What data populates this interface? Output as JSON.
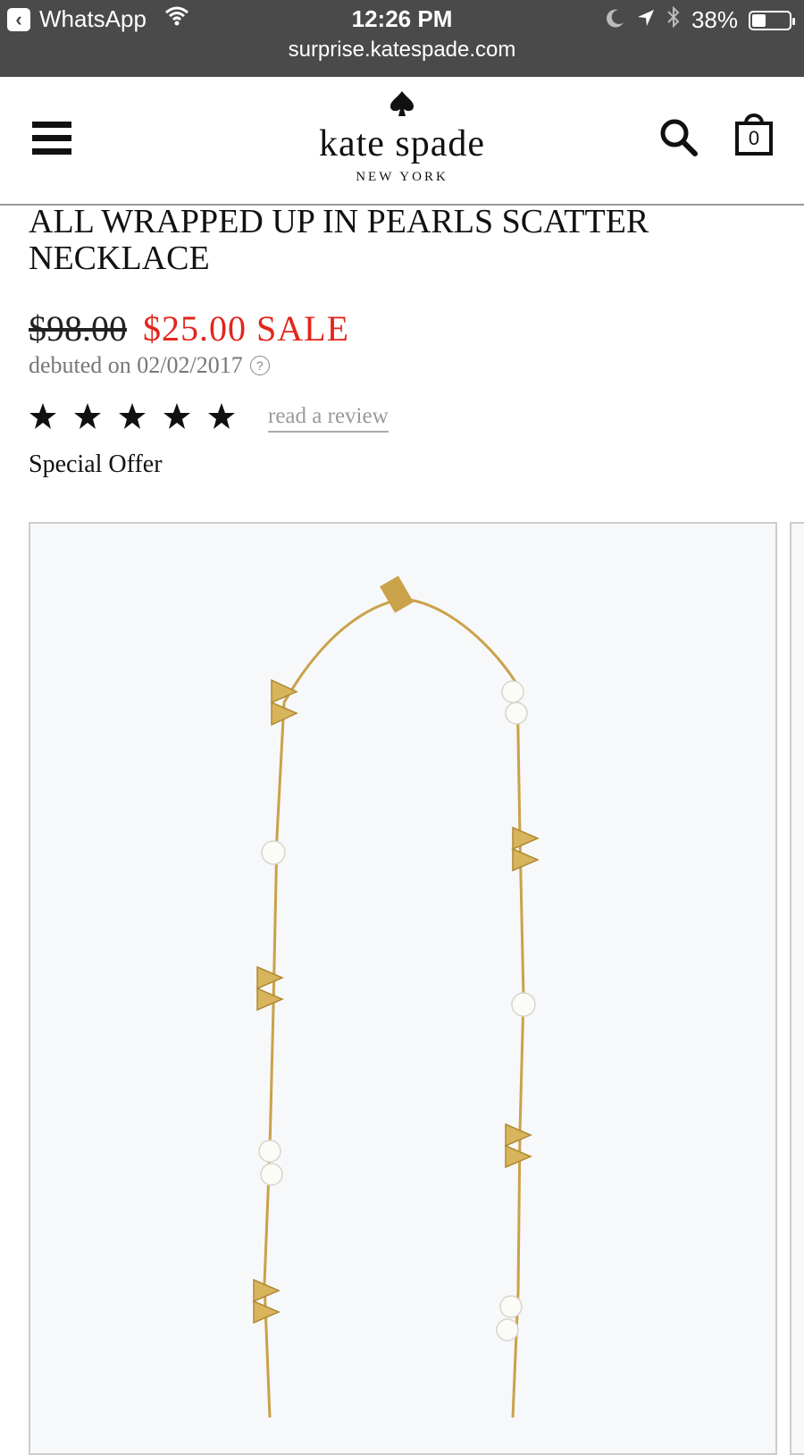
{
  "status_bar": {
    "back_app": "WhatsApp",
    "time": "12:26 PM",
    "battery": "38%",
    "battery_level": 0.38,
    "url": "surprise.katespade.com"
  },
  "header": {
    "logo_name": "kate spade",
    "logo_sub": "NEW YORK",
    "cart_count": "0"
  },
  "product": {
    "title": "ALL WRAPPED UP IN PEARLS SCATTER NECKLACE",
    "price_original": "$98.00",
    "price_sale": "$25.00 SALE",
    "debuted": "debuted on 02/02/2017",
    "rating": 5,
    "review_link": "read a review",
    "offer": "Special Offer"
  },
  "colors": {
    "sale_red": "#e1261c",
    "status_bar_bg": "#4a4a4a",
    "gold": "#c9a24a"
  }
}
